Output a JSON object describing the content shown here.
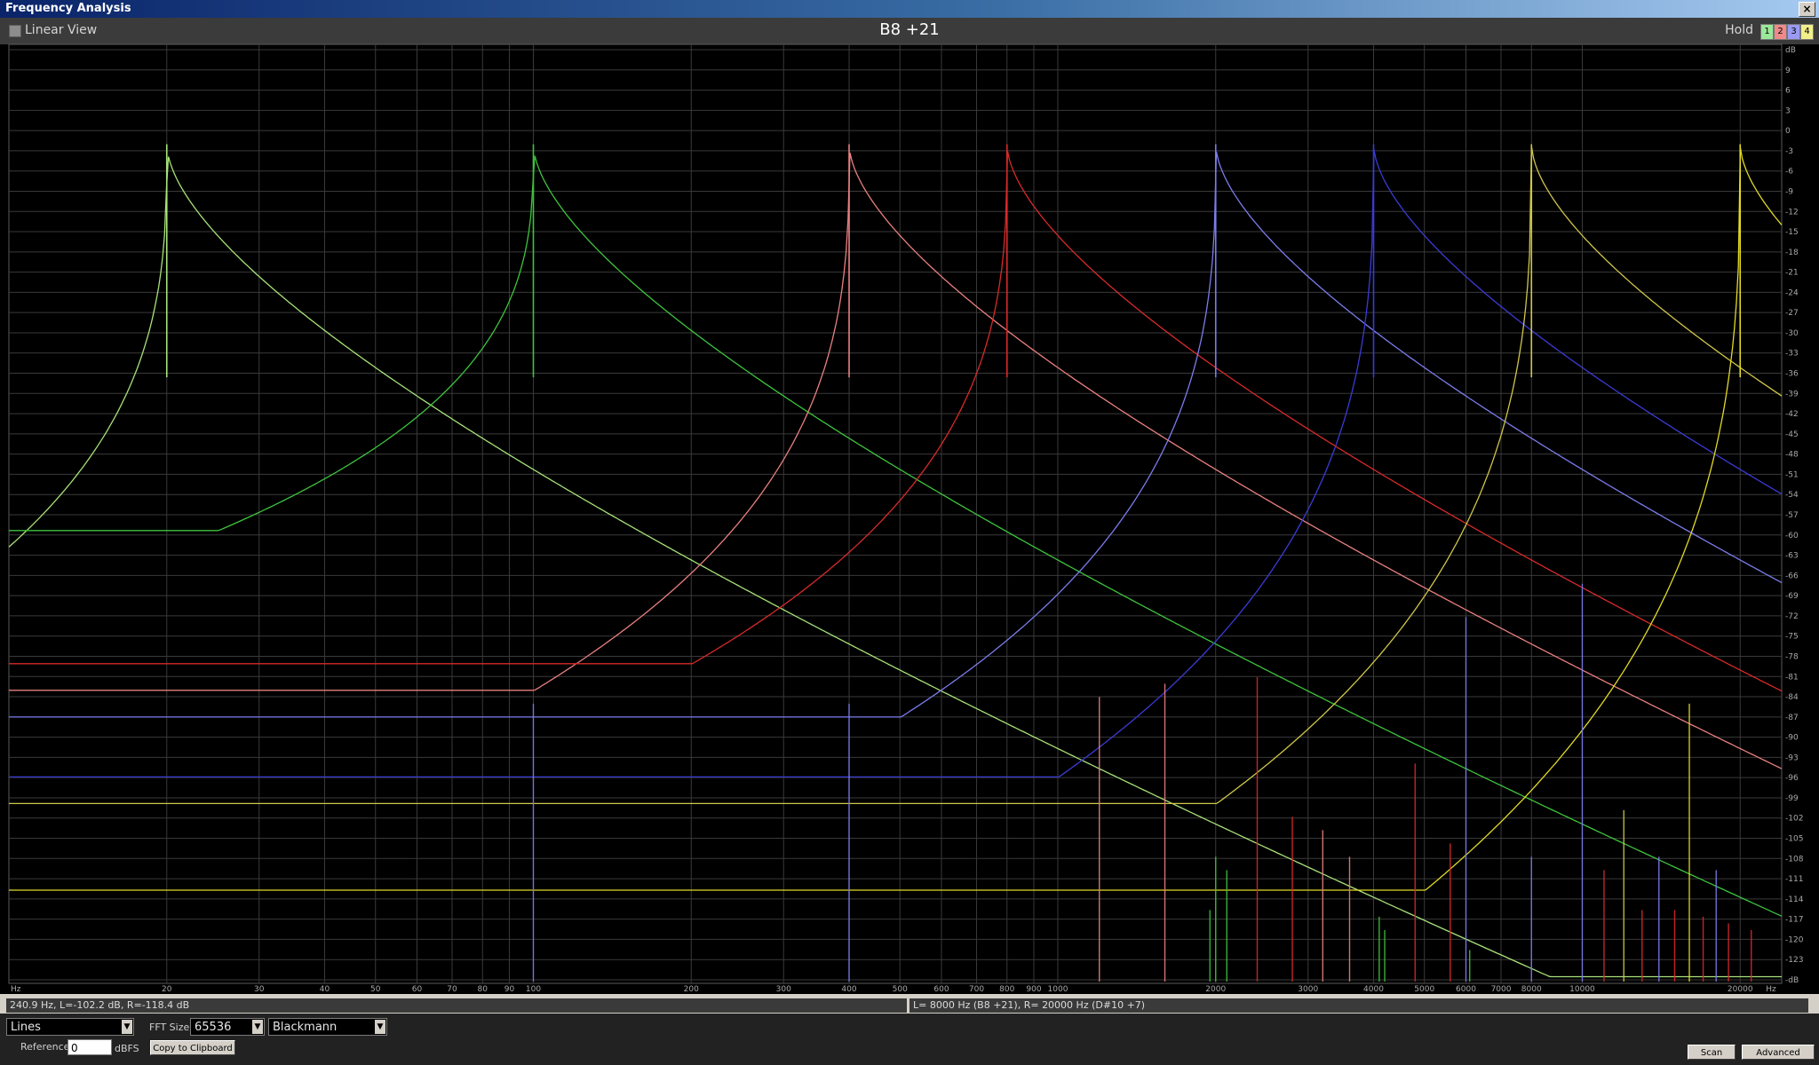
{
  "window": {
    "title": "Frequency Analysis",
    "close_glyph": "×"
  },
  "header": {
    "linear_view_label": "Linear View",
    "note_title": "B8 +21",
    "hold_label": "Hold",
    "hold_buttons": [
      {
        "label": "1",
        "color": "#9be89b"
      },
      {
        "label": "2",
        "color": "#f08a8a"
      },
      {
        "label": "3",
        "color": "#9a9af2"
      },
      {
        "label": "4",
        "color": "#f2ef8a"
      }
    ]
  },
  "plot": {
    "db_ticks": [
      "dB",
      "9",
      "6",
      "3",
      "0",
      "-3",
      "-6",
      "-9",
      "-12",
      "-15",
      "-18",
      "-21",
      "-24",
      "-27",
      "-30",
      "-33",
      "-36",
      "-39",
      "-42",
      "-45",
      "-48",
      "-51",
      "-54",
      "-57",
      "-60",
      "-63",
      "-66",
      "-69",
      "-72",
      "-75",
      "-78",
      "-81",
      "-84",
      "-87",
      "-90",
      "-93",
      "-96",
      "-99",
      "-102",
      "-105",
      "-108",
      "-111",
      "-114",
      "-117",
      "-120",
      "-123",
      "-dB"
    ],
    "freq_ticks": [
      {
        "label": "Hz",
        "f": 10
      },
      {
        "label": "20",
        "f": 20
      },
      {
        "label": "30",
        "f": 30
      },
      {
        "label": "40",
        "f": 40
      },
      {
        "label": "50",
        "f": 50
      },
      {
        "label": "60",
        "f": 60
      },
      {
        "label": "70",
        "f": 70
      },
      {
        "label": "80",
        "f": 80
      },
      {
        "label": "90",
        "f": 90
      },
      {
        "label": "100",
        "f": 100
      },
      {
        "label": "200",
        "f": 200
      },
      {
        "label": "300",
        "f": 300
      },
      {
        "label": "400",
        "f": 400
      },
      {
        "label": "500",
        "f": 500
      },
      {
        "label": "600",
        "f": 600
      },
      {
        "label": "700",
        "f": 700
      },
      {
        "label": "800",
        "f": 800
      },
      {
        "label": "900",
        "f": 900
      },
      {
        "label": "1000",
        "f": 1000
      },
      {
        "label": "2000",
        "f": 2000
      },
      {
        "label": "3000",
        "f": 3000
      },
      {
        "label": "4000",
        "f": 4000
      },
      {
        "label": "5000",
        "f": 5000
      },
      {
        "label": "6000",
        "f": 6000
      },
      {
        "label": "7000",
        "f": 7000
      },
      {
        "label": "8000",
        "f": 8000
      },
      {
        "label": "10000",
        "f": 10000
      },
      {
        "label": "20000",
        "f": 20000
      },
      {
        "label": "Hz",
        "f": 24000
      }
    ]
  },
  "chart_data": {
    "type": "line",
    "x_scale": "log",
    "xlim_hz": [
      10,
      24000
    ],
    "ylim_db": [
      -129,
      12
    ],
    "series": [
      {
        "color": "#a8e27a",
        "peak_hz": 20,
        "peak_db": -3,
        "floor_db": -158,
        "base_db": -80,
        "lo_hz": 10
      },
      {
        "color": "#3ec43e",
        "peak_hz": 100,
        "peak_db": -3,
        "floor_db": -158,
        "base_db": -61,
        "lo_hz": 10
      },
      {
        "color": "#e98080",
        "peak_hz": 400,
        "peak_db": -3,
        "floor_db": -158,
        "base_db": -85,
        "lo_hz": 10
      },
      {
        "color": "#d82a2a",
        "peak_hz": 800,
        "peak_db": -3,
        "floor_db": -158,
        "base_db": -81,
        "lo_hz": 10
      },
      {
        "color": "#7c7cec",
        "peak_hz": 2000,
        "peak_db": -3,
        "floor_db": -168,
        "base_db": -89,
        "lo_hz": 10
      },
      {
        "color": "#3b3bd6",
        "peak_hz": 4000,
        "peak_db": -3,
        "floor_db": -168,
        "base_db": -98,
        "lo_hz": 10
      },
      {
        "color": "#cfc64a",
        "peak_hz": 8000,
        "peak_db": -3,
        "floor_db": -168,
        "base_db": -102,
        "lo_hz": 10
      },
      {
        "color": "#e1da28",
        "peak_hz": 20000,
        "peak_db": -3,
        "floor_db": -168,
        "base_db": -115,
        "lo_hz": 10
      }
    ],
    "spikes": [
      {
        "f": 100,
        "db": -87,
        "color": "#7c7cec"
      },
      {
        "f": 400,
        "db": -87,
        "color": "#7c7cec"
      },
      {
        "f": 1200,
        "db": -86,
        "color": "#e98080"
      },
      {
        "f": 1600,
        "db": -84,
        "color": "#e98080"
      },
      {
        "f": 2400,
        "db": -83,
        "color": "#d82a2a"
      },
      {
        "f": 2800,
        "db": -104,
        "color": "#d82a2a"
      },
      {
        "f": 3200,
        "db": -106,
        "color": "#e98080"
      },
      {
        "f": 3600,
        "db": -110,
        "color": "#e98080"
      },
      {
        "f": 4800,
        "db": -96,
        "color": "#d82a2a"
      },
      {
        "f": 5600,
        "db": -108,
        "color": "#d82a2a"
      },
      {
        "f": 6000,
        "db": -74,
        "color": "#7c7cec"
      },
      {
        "f": 8000,
        "db": -110,
        "color": "#7c7cec"
      },
      {
        "f": 10000,
        "db": -69,
        "color": "#7c7cec"
      },
      {
        "f": 12000,
        "db": -103,
        "color": "#cfc64a"
      },
      {
        "f": 14000,
        "db": -110,
        "color": "#7c7cec"
      },
      {
        "f": 16000,
        "db": -87,
        "color": "#e1da28"
      },
      {
        "f": 18000,
        "db": -112,
        "color": "#7c7cec"
      },
      {
        "f": 11000,
        "db": -112,
        "color": "#d82a2a"
      },
      {
        "f": 13000,
        "db": -118,
        "color": "#d82a2a"
      },
      {
        "f": 15000,
        "db": -118,
        "color": "#d82a2a"
      },
      {
        "f": 17000,
        "db": -119,
        "color": "#d82a2a"
      },
      {
        "f": 19000,
        "db": -120,
        "color": "#d82a2a"
      },
      {
        "f": 21000,
        "db": -121,
        "color": "#d82a2a"
      },
      {
        "f": 2000,
        "db": -110,
        "color": "#3ec43e"
      },
      {
        "f": 2100,
        "db": -112,
        "color": "#3ec43e"
      },
      {
        "f": 1950,
        "db": -118,
        "color": "#3ec43e"
      },
      {
        "f": 4100,
        "db": -119,
        "color": "#3ec43e"
      },
      {
        "f": 4200,
        "db": -121,
        "color": "#3ec43e"
      },
      {
        "f": 6100,
        "db": -124,
        "color": "#3ec43e"
      }
    ]
  },
  "status": {
    "cursor_readout": "240.9 Hz, L=-102.2 dB, R=-118.4 dB",
    "peak_readout": "L=  8000 Hz (B8 +21), R=  20000 Hz (D#10 +7)"
  },
  "controls": {
    "display_mode": "Lines",
    "fft_size_label": "FFT Size",
    "fft_size": "65536",
    "window": "Blackmann",
    "reference_label": "Reference",
    "reference_value": "0",
    "reference_unit": "dBFS",
    "copy_button": "Copy to Clipboard",
    "scan_button": "Scan",
    "advanced_button": "Advanced"
  }
}
